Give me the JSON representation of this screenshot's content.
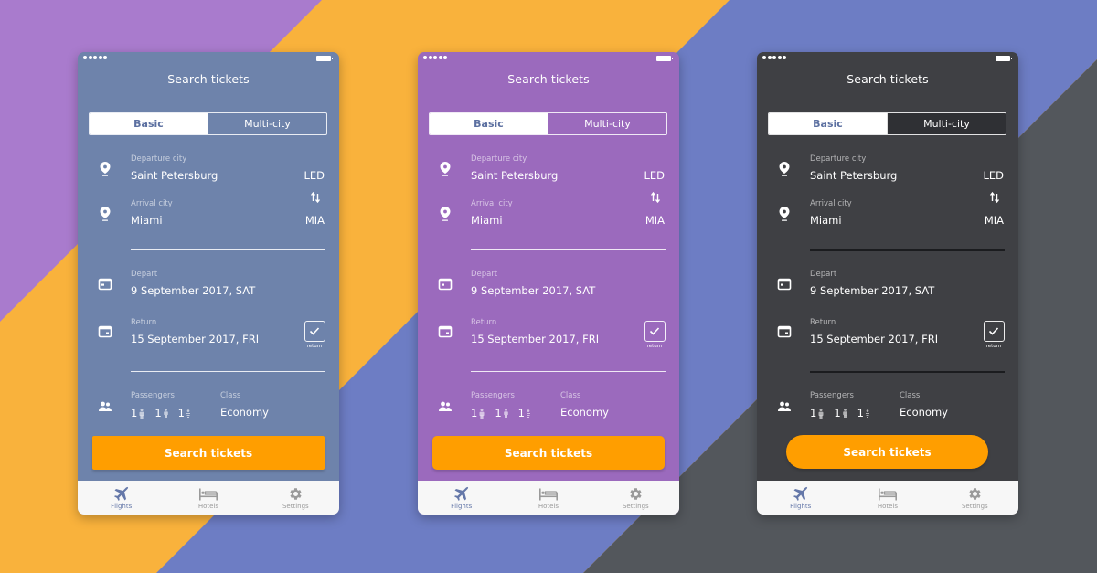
{
  "background": {
    "colors": {
      "purple": "#a97bcd",
      "orange": "#f9b23c",
      "blue": "#6d7dc4",
      "gray": "#53575c"
    }
  },
  "theme_colors": {
    "accent_button": "#ff9e00",
    "tab_active": "#6578a9",
    "tab_inactive": "#9a9a9a"
  },
  "screens": [
    {
      "variant": "blue-gray",
      "bg_color": "#6e83ab",
      "button_style": "square",
      "title": "Search tickets",
      "segments": {
        "basic": "Basic",
        "multi": "Multi-city"
      },
      "departure": {
        "label": "Departure city",
        "city": "Saint Petersburg",
        "code": "LED"
      },
      "arrival": {
        "label": "Arrival city",
        "city": "Miami",
        "code": "MIA"
      },
      "depart": {
        "label": "Depart",
        "date": "9 September 2017, SAT"
      },
      "return": {
        "label": "Return",
        "date": "15 September 2017, FRI",
        "checkbox_caption": "return",
        "checked": true
      },
      "passengers": {
        "label": "Passengers",
        "adults": "1",
        "children": "1",
        "infants": "1"
      },
      "class": {
        "label": "Class",
        "value": "Economy"
      },
      "search_button": "Search tickets",
      "tabs": [
        {
          "label": "Flights",
          "icon": "airplane-icon",
          "active": true
        },
        {
          "label": "Hotels",
          "icon": "bed-icon",
          "active": false
        },
        {
          "label": "Settings",
          "icon": "gear-icon",
          "active": false
        }
      ]
    },
    {
      "variant": "purple",
      "bg_color": "#9b6abd",
      "button_style": "rounded",
      "title": "Search tickets",
      "segments": {
        "basic": "Basic",
        "multi": "Multi-city"
      },
      "departure": {
        "label": "Departure city",
        "city": "Saint Petersburg",
        "code": "LED"
      },
      "arrival": {
        "label": "Arrival city",
        "city": "Miami",
        "code": "MIA"
      },
      "depart": {
        "label": "Depart",
        "date": "9 September 2017, SAT"
      },
      "return": {
        "label": "Return",
        "date": "15 September 2017, FRI",
        "checkbox_caption": "return",
        "checked": true
      },
      "passengers": {
        "label": "Passengers",
        "adults": "1",
        "children": "1",
        "infants": "1"
      },
      "class": {
        "label": "Class",
        "value": "Economy"
      },
      "search_button": "Search tickets",
      "tabs": [
        {
          "label": "Flights",
          "icon": "airplane-icon",
          "active": true
        },
        {
          "label": "Hotels",
          "icon": "bed-icon",
          "active": false
        },
        {
          "label": "Settings",
          "icon": "gear-icon",
          "active": false
        }
      ]
    },
    {
      "variant": "dark",
      "bg_color": "#3f4044",
      "button_style": "pill",
      "title": "Search tickets",
      "segments": {
        "basic": "Basic",
        "multi": "Multi-city"
      },
      "departure": {
        "label": "Departure city",
        "city": "Saint Petersburg",
        "code": "LED"
      },
      "arrival": {
        "label": "Arrival city",
        "city": "Miami",
        "code": "MIA"
      },
      "depart": {
        "label": "Depart",
        "date": "9 September 2017, SAT"
      },
      "return": {
        "label": "Return",
        "date": "15 September 2017, FRI",
        "checkbox_caption": "return",
        "checked": true
      },
      "passengers": {
        "label": "Passengers",
        "adults": "1",
        "children": "1",
        "infants": "1"
      },
      "class": {
        "label": "Class",
        "value": "Economy"
      },
      "search_button": "Search tickets",
      "tabs": [
        {
          "label": "Flights",
          "icon": "airplane-icon",
          "active": true
        },
        {
          "label": "Hotels",
          "icon": "bed-icon",
          "active": false
        },
        {
          "label": "Settings",
          "icon": "gear-icon",
          "active": false
        }
      ]
    }
  ]
}
